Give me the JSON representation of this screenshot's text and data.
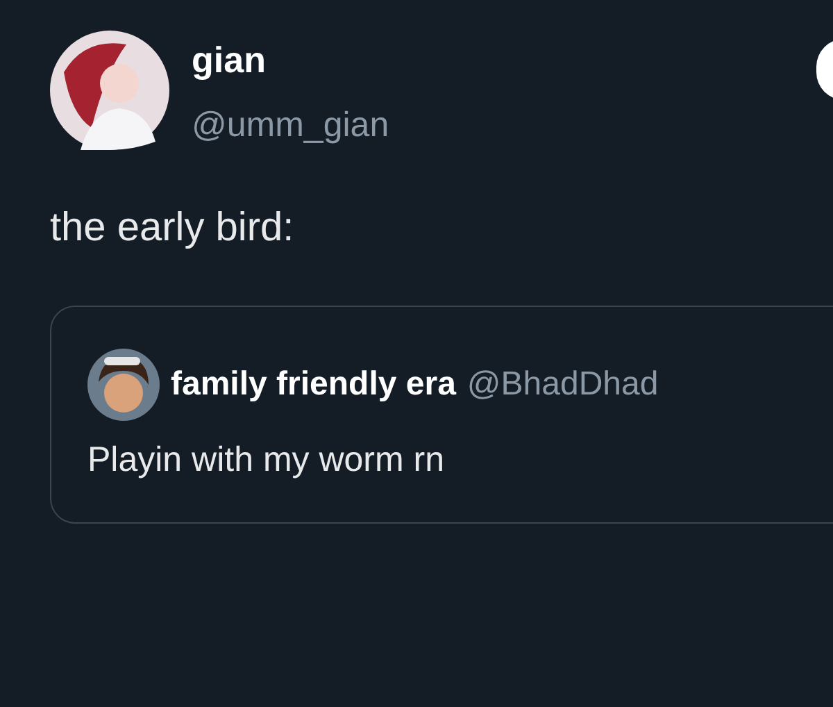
{
  "post": {
    "author": {
      "name": "gian",
      "handle": "@umm_gian"
    },
    "text": "the early bird:",
    "quote": {
      "author": {
        "name": "family friendly era",
        "handle": "@BhadDhad"
      },
      "text": "Playin with my worm rn"
    }
  }
}
